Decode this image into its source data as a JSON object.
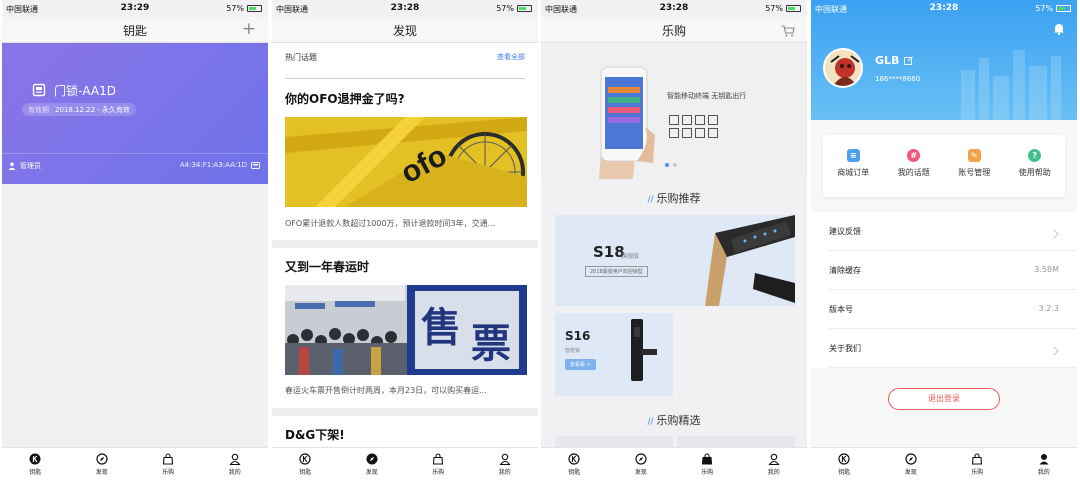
{
  "screens": [
    {
      "status": {
        "carrier": "中国联通",
        "time": "23:29",
        "battery": "57%"
      },
      "title": "钥匙",
      "add_icon": "plus-icon",
      "lock": {
        "name": "门锁-AA1D",
        "validity_label": "有效期",
        "validity_value": "2018.12.22 - 永久有效",
        "role": "管理员",
        "mac": "A4:34:F1:A3:AA:1D",
        "card_color": "#7a73ea"
      }
    },
    {
      "status": {
        "carrier": "中国联通",
        "time": "23:28",
        "battery": "57%"
      },
      "title": "发现",
      "topics_label": "热门话题",
      "see_all": "查看全部",
      "articles": [
        {
          "headline": "你的OFO退押金了吗?",
          "summary": "OFO累计退款人数超过1000万，预计退款时间3年，交通..."
        },
        {
          "headline": "又到一年春运时",
          "summary": "春运火车票开售倒计时两周，本月23日，可以购买春运..."
        },
        {
          "headline": "D&G下架!"
        }
      ]
    },
    {
      "status": {
        "carrier": "中国联通",
        "time": "23:28",
        "battery": "57%"
      },
      "title": "乐购",
      "cart_icon": "cart-icon",
      "banner_tagline": "智能移动终端 无钥匙出行",
      "section_recommend": "乐购推荐",
      "section_selected": "乐购精选",
      "promo_s18": {
        "model": "S18",
        "edition": "旗舰版",
        "tag": "2018最受用户欢迎锁型"
      },
      "promo_s16": {
        "model": "S16",
        "edition": "智能锁",
        "button": "去看看 >"
      },
      "accent": "#4a8df8"
    },
    {
      "status": {
        "carrier": "中国联通",
        "time": "23:28",
        "battery": "57%"
      },
      "user": {
        "name": "GLB",
        "phone": "186****8660"
      },
      "quick_actions": [
        {
          "label": "商城订单",
          "icon": "order-icon",
          "color": "#4aa0ee"
        },
        {
          "label": "我的话题",
          "icon": "topic-icon",
          "color": "#f0567a"
        },
        {
          "label": "账号管理",
          "icon": "account-icon",
          "color": "#f3a34a"
        },
        {
          "label": "使用帮助",
          "icon": "help-icon",
          "color": "#45c08d"
        }
      ],
      "settings": [
        {
          "label": "建议反馈",
          "value": ""
        },
        {
          "label": "清除缓存",
          "value": "3.58M"
        },
        {
          "label": "版本号",
          "value": "3.2.3"
        },
        {
          "label": "关于我们",
          "value": ""
        }
      ],
      "logout": "退出登录",
      "logout_color": "#e85b57"
    }
  ],
  "tabs": [
    {
      "label": "钥匙",
      "icon": "key-tab-icon"
    },
    {
      "label": "发现",
      "icon": "compass-icon"
    },
    {
      "label": "乐购",
      "icon": "shopping-bag-icon"
    },
    {
      "label": "我的",
      "icon": "user-icon"
    }
  ],
  "active_tab_per_screen": [
    "钥匙",
    "发现",
    "乐购",
    "我的"
  ]
}
